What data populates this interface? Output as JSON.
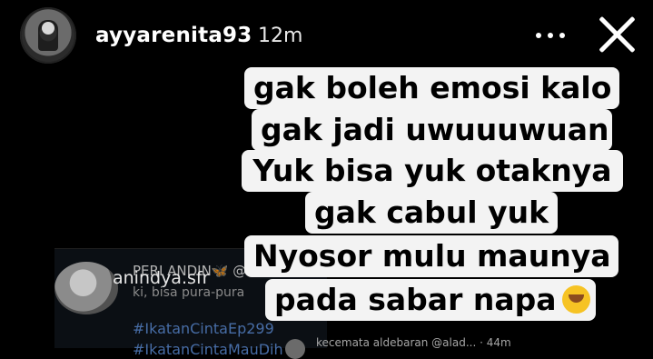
{
  "header": {
    "username": "ayyarenita93",
    "timestamp": "12m",
    "more_icon": "more-options-icon",
    "close_icon": "close-icon"
  },
  "background_post": {
    "author": "PERI ANDIN🦋 @a",
    "text": "ki, bisa pura-pura",
    "overlay_handle": "anindya.sfr",
    "hashtags": [
      "#IkatanCintaEp299",
      "#IkatanCintaMauDih"
    ],
    "reply_user": "kecemata aldebaran @alad... · 44m"
  },
  "caption": {
    "lines": [
      "gak boleh emosi kalo",
      "gak jadi uwuuuwuan",
      "Yuk bisa yuk otaknya",
      "gak cabul yuk",
      "Nyosor mulu maunya",
      "pada sabar napa"
    ],
    "emoji": "🤣"
  },
  "colors": {
    "background": "#000000",
    "caption_bg": "#f3f3f3",
    "hashtag": "#4f79b8"
  }
}
